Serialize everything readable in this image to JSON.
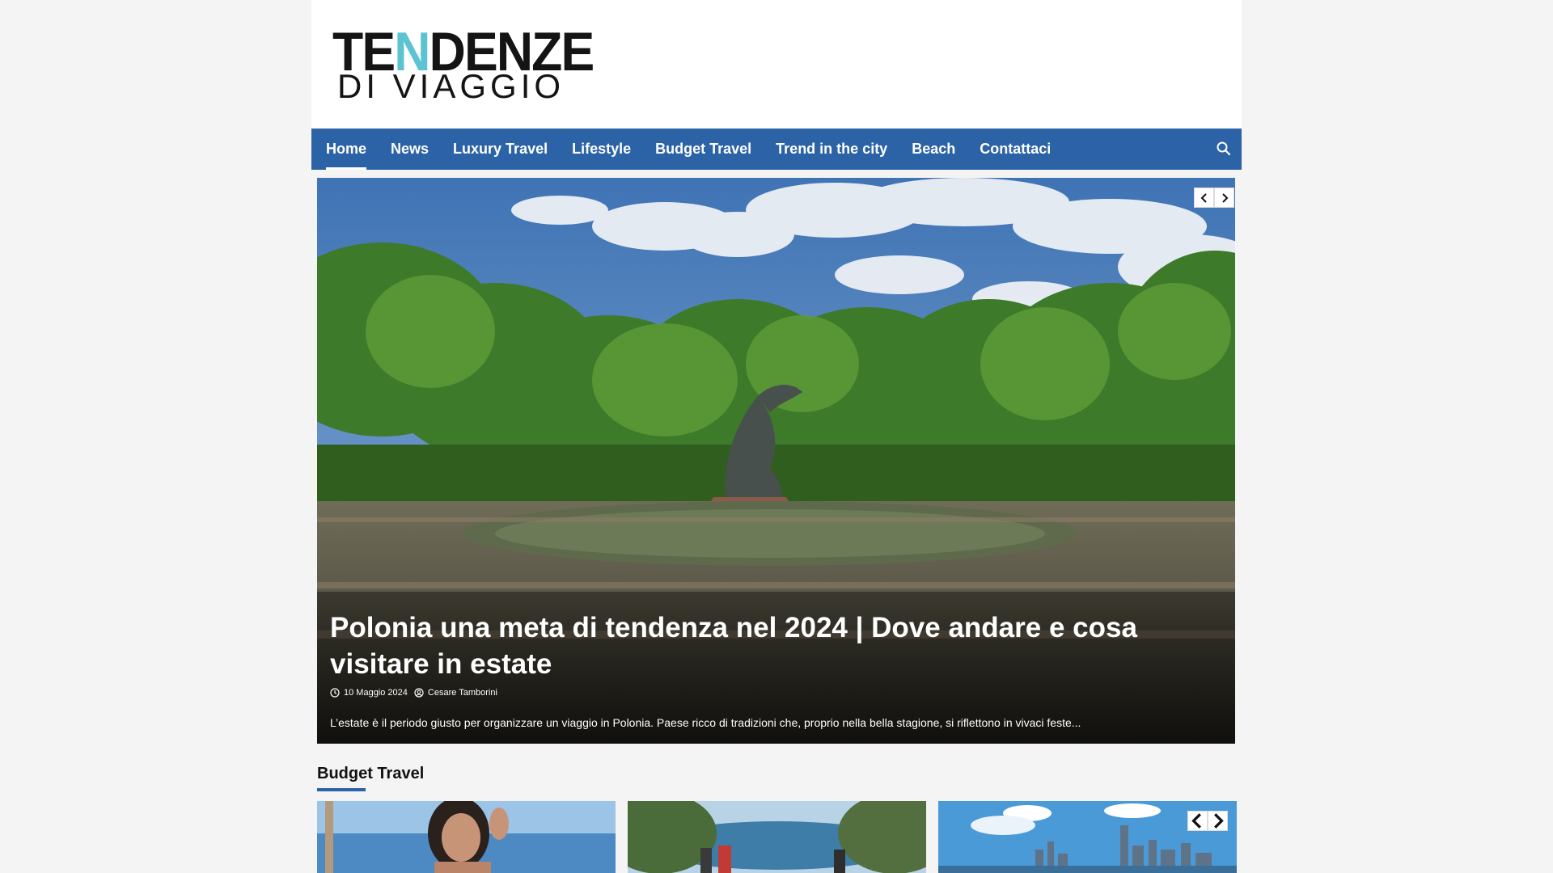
{
  "brand": {
    "logo_line1_a": "TE",
    "logo_line1_accent": "N",
    "logo_line1_b": "DENZE",
    "logo_line2": "DI VIAGGIO",
    "accent_color": "#5cc3d3"
  },
  "nav": {
    "items": [
      {
        "label": "Home",
        "active": true
      },
      {
        "label": "News"
      },
      {
        "label": "Luxury Travel"
      },
      {
        "label": "Lifestyle"
      },
      {
        "label": "Budget Travel"
      },
      {
        "label": "Trend in the city"
      },
      {
        "label": "Beach"
      },
      {
        "label": "Contattaci"
      }
    ],
    "search_icon": "search-icon",
    "bar_color": "#2c63a6"
  },
  "hero": {
    "title": "Polonia una meta di tendenza nel 2024 | Dove andare e cosa visitare in estate",
    "date": "10 Maggio 2024",
    "author": "Cesare Tamborini",
    "excerpt": "L’estate è il periodo giusto per organizzare un viaggio in Polonia. Paese ricco di tradizioni che, proprio nella bella stagione, si riflettono in vivaci feste...",
    "date_icon": "clock-icon",
    "author_icon": "user-icon"
  },
  "section": {
    "title": "Budget Travel",
    "cards": [
      {
        "image": "woman-beach-photo"
      },
      {
        "image": "lake-hikers-photo"
      },
      {
        "image": "city-skyline-photo"
      }
    ]
  }
}
